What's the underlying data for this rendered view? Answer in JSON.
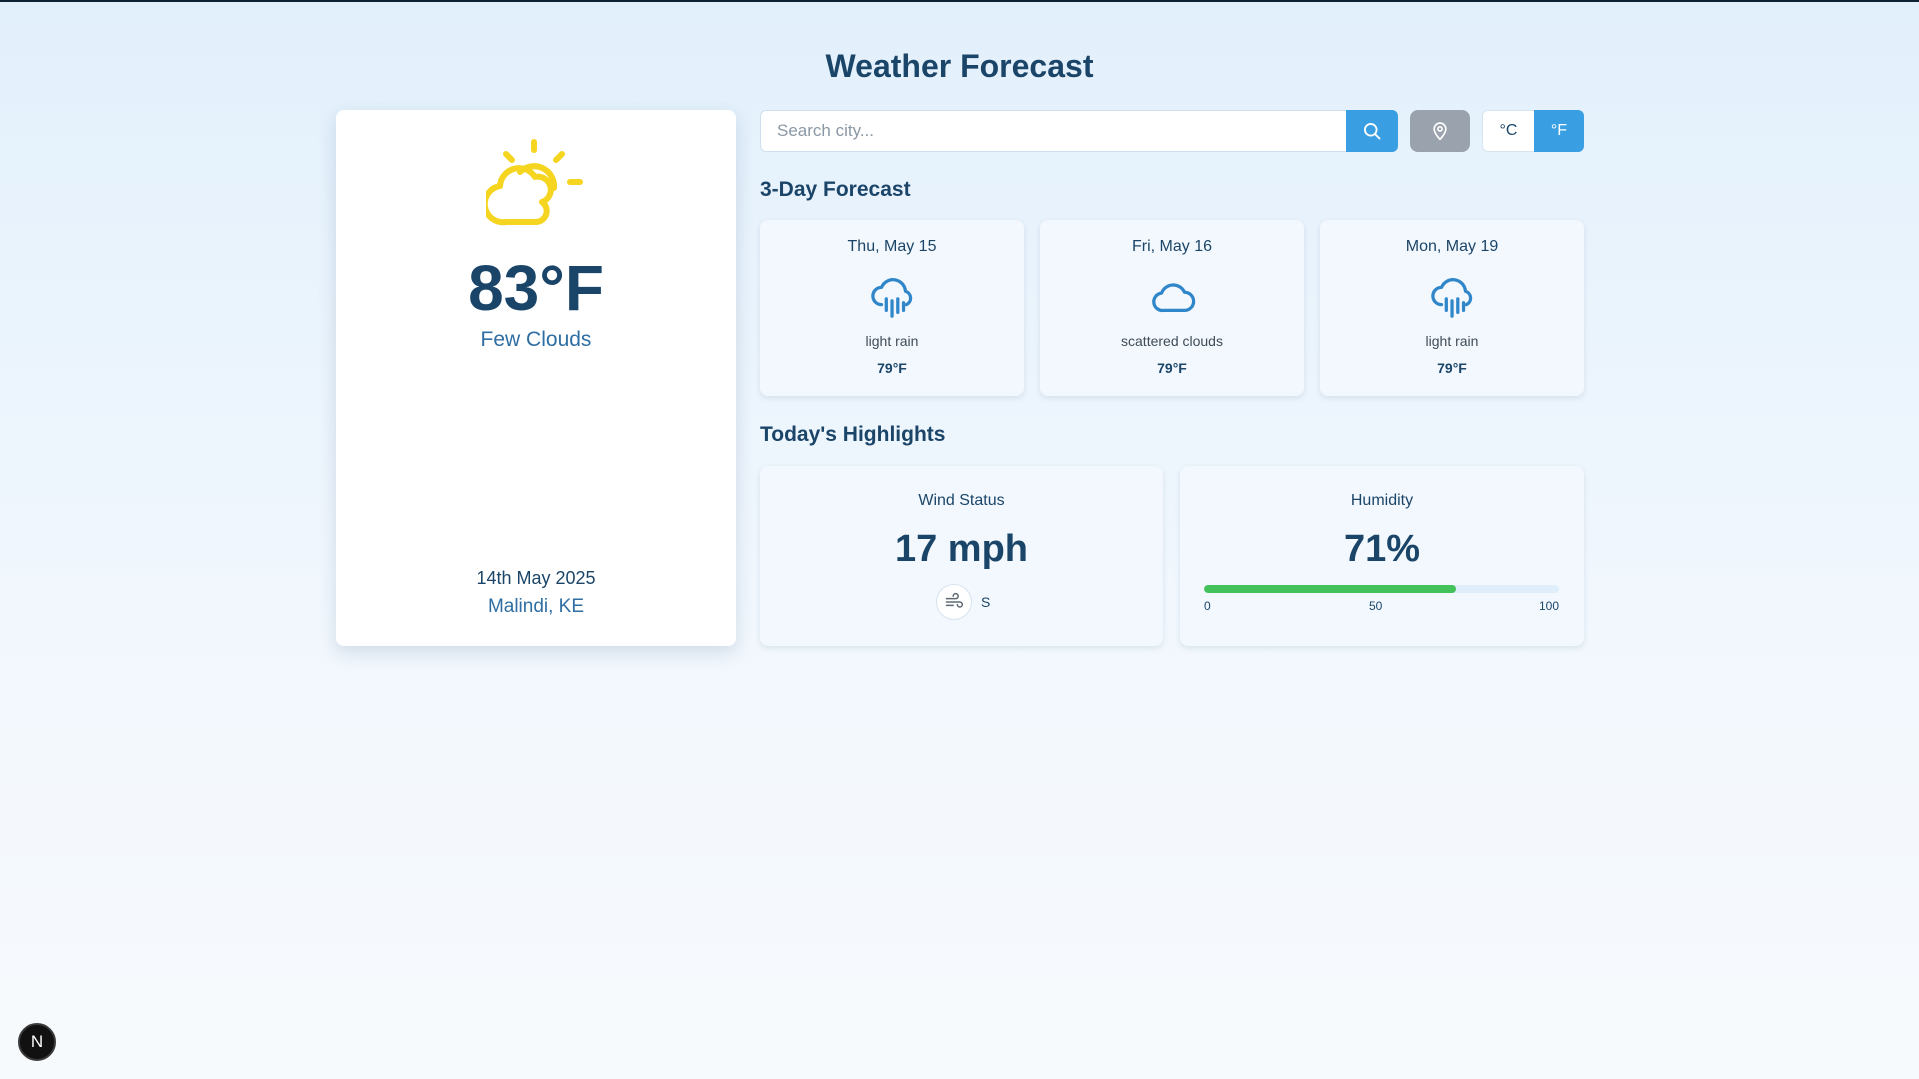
{
  "page": {
    "title": "Weather Forecast"
  },
  "current": {
    "icon": "partly-sunny-icon",
    "temperature": "83°F",
    "condition": "Few Clouds",
    "date": "14th May 2025",
    "location": "Malindi, KE"
  },
  "search": {
    "placeholder": "Search city...",
    "value": "",
    "button_icon": "search-icon"
  },
  "location_button": {
    "icon": "map-pin-icon"
  },
  "units": {
    "celsius": "°C",
    "fahrenheit": "°F",
    "selected": "°F"
  },
  "forecast": {
    "title": "3-Day Forecast",
    "days": [
      {
        "date": "Thu, May 15",
        "icon": "rain-cloud-icon",
        "description": "light rain",
        "temp": "79°F"
      },
      {
        "date": "Fri, May 16",
        "icon": "cloud-icon",
        "description": "scattered clouds",
        "temp": "79°F"
      },
      {
        "date": "Mon, May 19",
        "icon": "rain-cloud-icon",
        "description": "light rain",
        "temp": "79°F"
      }
    ]
  },
  "highlights": {
    "title": "Today's Highlights",
    "wind": {
      "title": "Wind Status",
      "value": "17 mph",
      "direction": "S",
      "icon": "wind-icon"
    },
    "humidity": {
      "title": "Humidity",
      "value": "71%",
      "percent": 71,
      "scale": [
        "0",
        "50",
        "100"
      ]
    }
  },
  "fab": {
    "label": "N"
  },
  "colors": {
    "accent": "#3a9fe2",
    "heading": "#1b4568",
    "sun": "#f5d51f",
    "forecast_icon": "#2f86c8",
    "humidity_bar": "#43c25c"
  }
}
